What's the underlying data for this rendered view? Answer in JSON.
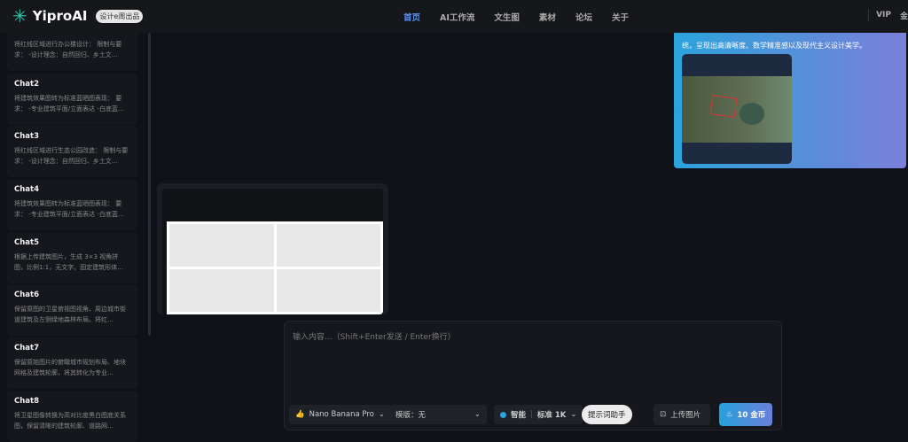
{
  "header": {
    "logo": "YiproAI",
    "badge": "设计e周出品",
    "nav": [
      {
        "label": "首页",
        "active": true
      },
      {
        "label": "AI工作流"
      },
      {
        "label": "文生图"
      },
      {
        "label": "素材"
      },
      {
        "label": "论坛"
      },
      {
        "label": "关于"
      }
    ],
    "vip": "VIP",
    "coins_partial": "金"
  },
  "sidebar": {
    "chats": [
      {
        "title": "Chat1",
        "desc": "将红线区域进行办公楼设计： 限制与要求： -设计理念：自然回归、乡土文..."
      },
      {
        "title": "Chat2",
        "desc": "将建筑效果图转为标准蓝晒图表现： 要求： -专业建筑平面/立面表达 -白底蓝..."
      },
      {
        "title": "Chat3",
        "desc": "将红线区域进行生态公园改造： 限制与要求： -设计理念：自然回归、乡土文..."
      },
      {
        "title": "Chat4",
        "desc": "将建筑效果图转为标准蓝晒图表现： 要求： -专业建筑平面/立面表达 -白底蓝..."
      },
      {
        "title": "Chat5",
        "desc": "根据上传建筑图片，生成 3×3 视角拼图，比例1:1，无文字。固定建筑形体..."
      },
      {
        "title": "Chat6",
        "desc": "保留原图的卫星俯视图视角、周边城市街道建筑及左侧绿地森林布局。将红..."
      },
      {
        "title": "Chat7",
        "desc": "保留原始图片的俯瞰城市规划布局、地块网格及建筑轮廓，将其转化为专业..."
      },
      {
        "title": "Chat8",
        "desc": "将卫星图像转换为高对比度黑白图底关系图，保留清晰的建筑轮廓、道路网..."
      }
    ]
  },
  "message": {
    "text": "统，呈现出高清晰度、数学精准感以及现代主义设计美学。"
  },
  "composer": {
    "placeholder": "输入内容...（Shift+Enter发送 / Enter换行）",
    "model": "Nano Banana Pro",
    "template": "模版：无",
    "mode": "智能",
    "quality": "标准 1K",
    "assistant": "提示词助手",
    "upload": "上传图片",
    "send": "10 金币"
  }
}
